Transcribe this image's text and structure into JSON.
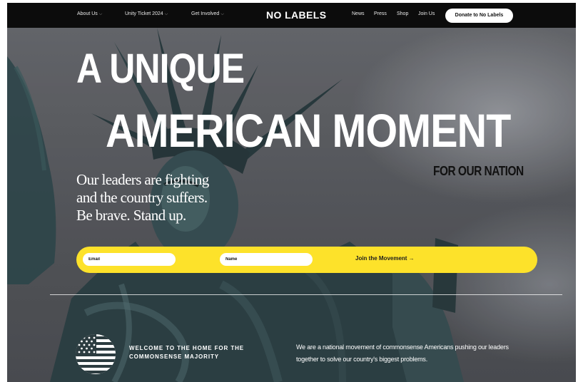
{
  "nav": {
    "left_items": [
      {
        "label": "About Us",
        "has_caret": true
      },
      {
        "label": "Unity Ticket 2024",
        "has_caret": true
      },
      {
        "label": "Get Involved",
        "has_caret": true
      }
    ],
    "logo": "NO LABELS",
    "right_items": [
      {
        "label": "News"
      },
      {
        "label": "Press"
      },
      {
        "label": "Shop"
      },
      {
        "label": "Join Us"
      }
    ],
    "donate_label": "Donate to No Labels",
    "caret_icon": "chevron-down-icon"
  },
  "hero": {
    "headline_line1": "A UNIQUE",
    "headline_line2": "AMERICAN MOMENT",
    "subheadline": "FOR OUR NATION",
    "tagline": [
      "Our leaders are fighting",
      "and the country suffers.",
      "Be brave. Stand up."
    ],
    "background_subject": "statue-of-liberty-photo"
  },
  "signup": {
    "email_placeholder": "Email",
    "email_value": "",
    "name_placeholder": "Name",
    "name_value": "",
    "submit_label": "Join the Movement →",
    "bar_color": "#fde22a"
  },
  "welcome": {
    "flag_icon": "american-flag-icon",
    "heading": "WELCOME TO THE HOME FOR THE COMMONSENSE MAJORITY",
    "mission": "We are a national movement of commonsense Americans pushing our leaders together to solve our country's biggest problems."
  }
}
